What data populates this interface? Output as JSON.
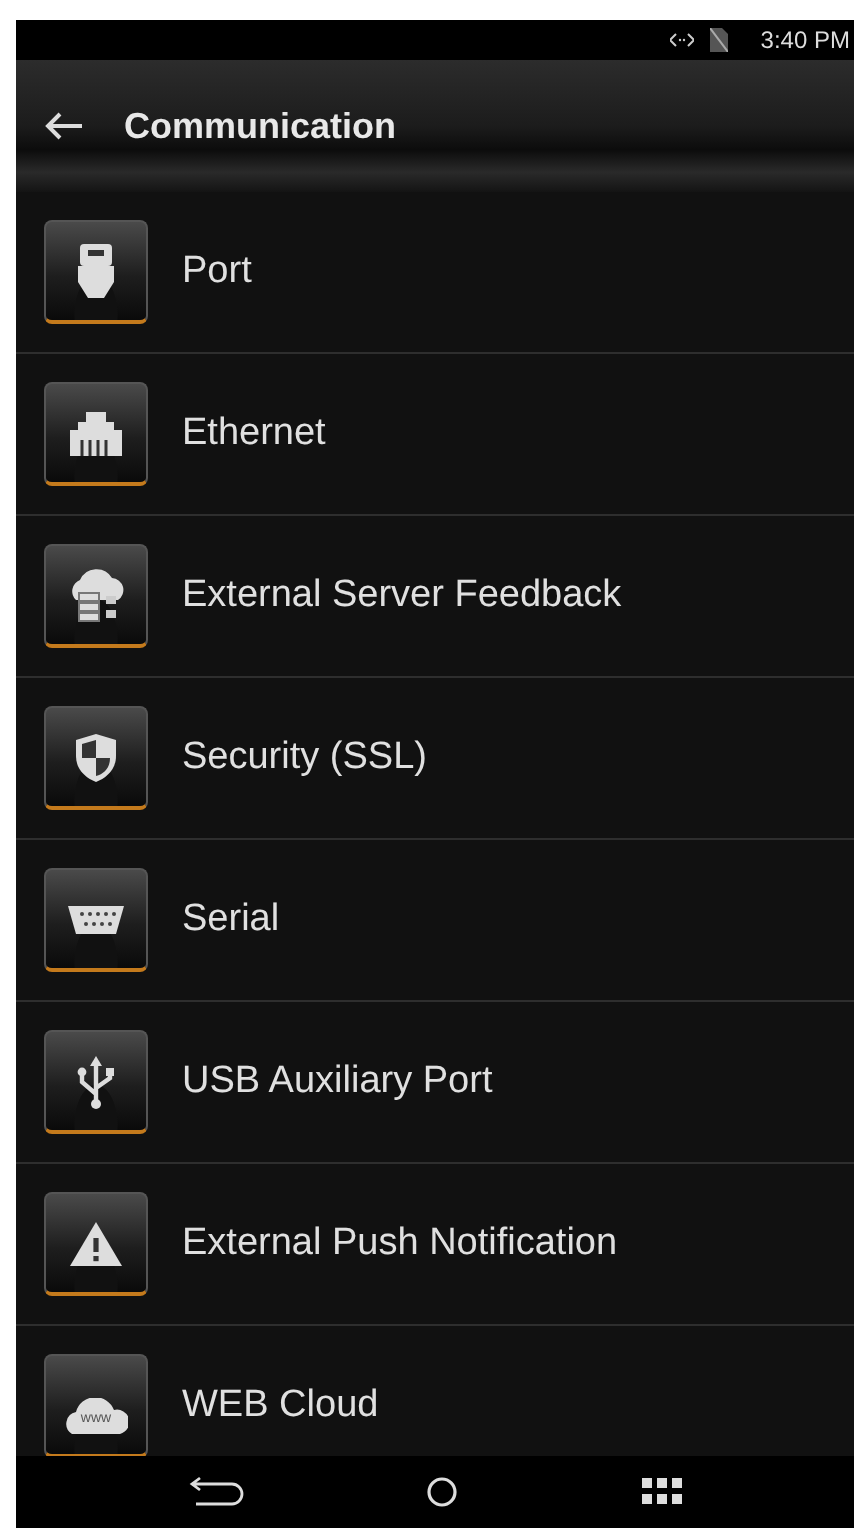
{
  "status_bar": {
    "time": "3:40 PM"
  },
  "header": {
    "title": "Communication"
  },
  "items": [
    {
      "label": "Port",
      "kind": "port"
    },
    {
      "label": "Ethernet",
      "kind": "ethernet"
    },
    {
      "label": "External Server Feedback",
      "kind": "server"
    },
    {
      "label": "Security (SSL)",
      "kind": "shield"
    },
    {
      "label": "Serial",
      "kind": "serial"
    },
    {
      "label": "USB Auxiliary Port",
      "kind": "usb"
    },
    {
      "label": "External Push Notification",
      "kind": "warning"
    },
    {
      "label": "WEB Cloud",
      "kind": "cloud",
      "icon_text": "www"
    }
  ]
}
